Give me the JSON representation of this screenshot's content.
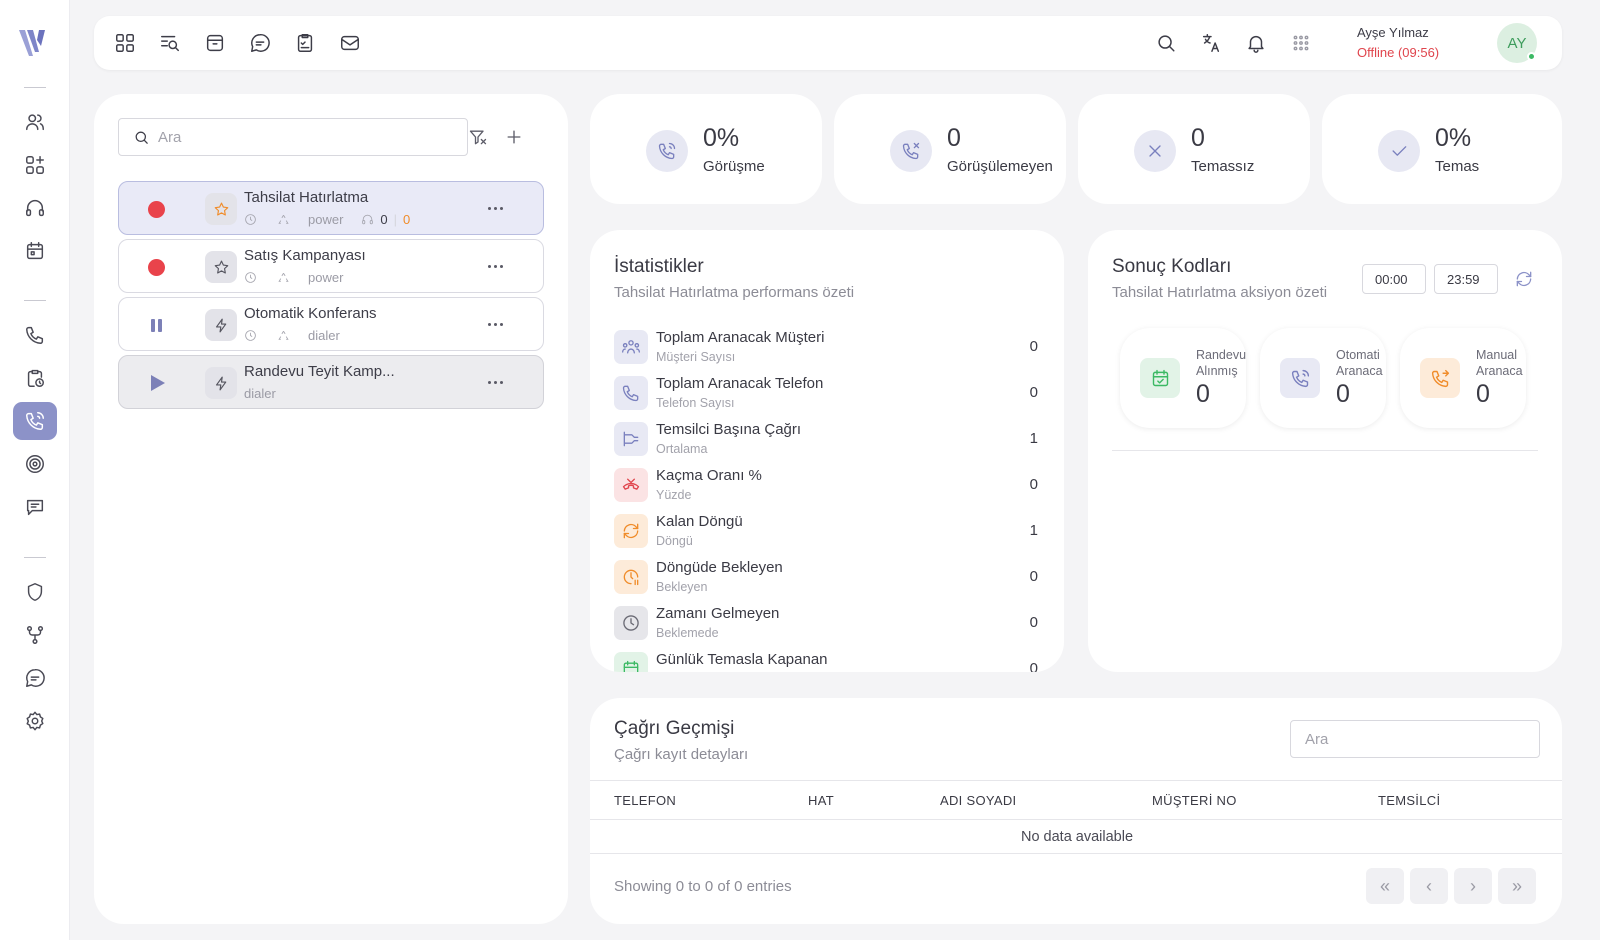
{
  "app": {
    "brand_icon": "brand-logo-icon"
  },
  "rail": {
    "items": [
      {
        "name": "users-icon"
      },
      {
        "name": "apps-icon"
      },
      {
        "name": "headset-icon"
      },
      {
        "name": "calendar-icon"
      },
      {
        "name": "phone-icon"
      },
      {
        "name": "clipboard-clock-icon"
      },
      {
        "name": "phone-active-icon"
      },
      {
        "name": "target-icon"
      },
      {
        "name": "message-square-icon"
      },
      {
        "name": "shield-icon"
      },
      {
        "name": "git-fork-icon"
      },
      {
        "name": "chat-bubble-icon"
      },
      {
        "name": "settings-icon"
      }
    ]
  },
  "topbar": {
    "user_name": "Ayşe Yılmaz",
    "user_status": "Offline (09:56)",
    "avatar_initials": "AY"
  },
  "campaigns": {
    "search_placeholder": "Ara",
    "items": [
      {
        "name": "Tahsilat Hatırlatma",
        "mode": "power",
        "count_a": "0",
        "sep": "|",
        "count_b": "0",
        "state": "recording"
      },
      {
        "name": "Satış Kampanyası",
        "mode": "power",
        "state": "recording"
      },
      {
        "name": "Otomatik Konferans",
        "mode": "dialer",
        "state": "paused"
      },
      {
        "name": "Randevu Teyit Kamp...",
        "mode": "dialer",
        "state": "stopped"
      }
    ]
  },
  "stats_cards": [
    {
      "value": "0%",
      "label": "Görüşme"
    },
    {
      "value": "0",
      "label": "Görüşülemeyen"
    },
    {
      "value": "0",
      "label": "Temassız"
    },
    {
      "value": "0%",
      "label": "Temas"
    }
  ],
  "statistics": {
    "title": "İstatistikler",
    "subtitle": "Tahsilat Hatırlatma performans özeti",
    "rows": [
      {
        "label": "Toplam Aranacak Müşteri",
        "sub": "Müşteri Sayısı",
        "value": "0"
      },
      {
        "label": "Toplam Aranacak Telefon",
        "sub": "Telefon Sayısı",
        "value": "0"
      },
      {
        "label": "Temsilci Başına Çağrı",
        "sub": "Ortalama",
        "value": "1"
      },
      {
        "label": "Kaçma Oranı %",
        "sub": "Yüzde",
        "value": "0"
      },
      {
        "label": "Kalan Döngü",
        "sub": "Döngü",
        "value": "1"
      },
      {
        "label": "Döngüde Bekleyen",
        "sub": "Bekleyen",
        "value": "0"
      },
      {
        "label": "Zamanı Gelmeyen",
        "sub": "Beklemede",
        "value": "0"
      },
      {
        "label": "Günlük Temasla Kapanan",
        "sub": "",
        "value": "0"
      }
    ]
  },
  "result_codes": {
    "title": "Sonuç Kodları",
    "subtitle": "Tahsilat Hatırlatma aksiyon özeti",
    "time_from": "00:00",
    "time_to": "23:59",
    "cards": [
      {
        "line1": "Randevu",
        "line2": "Alınmış",
        "value": "0"
      },
      {
        "line1": "Otomati",
        "line2": "Aranaca",
        "value": "0"
      },
      {
        "line1": "Manual",
        "line2": "Aranaca",
        "value": "0"
      }
    ]
  },
  "call_history": {
    "title": "Çağrı Geçmişi",
    "subtitle": "Çağrı kayıt detayları",
    "search_placeholder": "Ara",
    "columns": [
      "TELEFON",
      "HAT",
      "ADI SOYADI",
      "MÜŞTERİ NO",
      "TEMSİLCİ"
    ],
    "empty_text": "No data available",
    "showing": "Showing 0 to 0 of 0 entries",
    "pagination": [
      "«",
      "‹",
      "›",
      "»"
    ]
  },
  "colors": {
    "accent": "#8c92c8",
    "record_red": "#e9434b",
    "offline_red": "#e0454d",
    "online_green": "#3cb964"
  }
}
